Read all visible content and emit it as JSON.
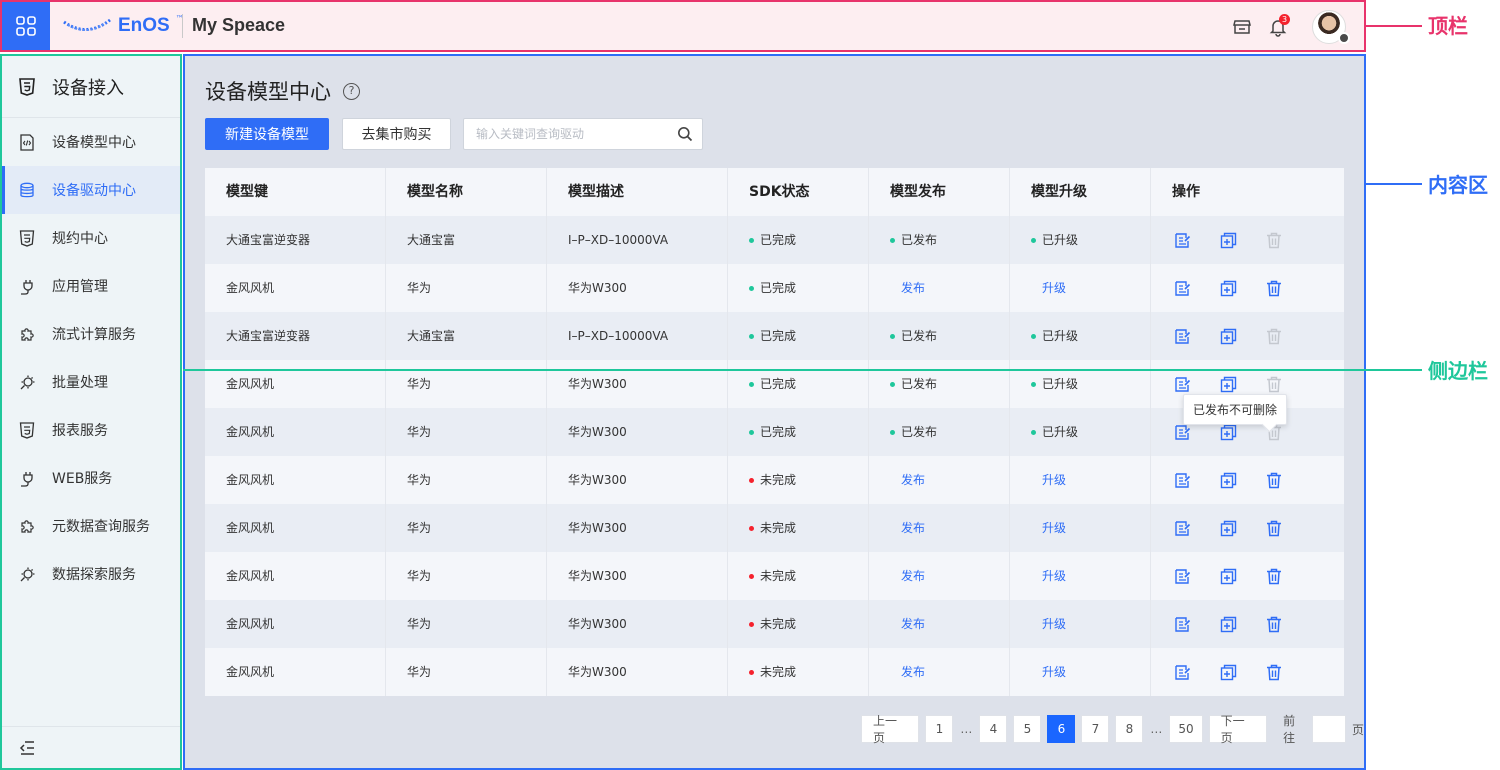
{
  "topbar": {
    "logo_text": "EnOS",
    "logo_tm": "™",
    "space_title": "My Speace",
    "notification_count": "3"
  },
  "annotations": {
    "topbar_label": "顶栏",
    "content_label": "内容区",
    "sidebar_label": "侧边栏",
    "topbar_color": "#e8336b",
    "content_color": "#2f6df6",
    "sidebar_color": "#1fc79b"
  },
  "sidebar": {
    "header": "设备接入",
    "items": [
      {
        "label": "设备模型中心",
        "icon": "code-doc-icon"
      },
      {
        "label": "设备驱动中心",
        "icon": "database-icon"
      },
      {
        "label": "规约中心",
        "icon": "html5-icon"
      },
      {
        "label": "应用管理",
        "icon": "plug-icon"
      },
      {
        "label": "流式计算服务",
        "icon": "puzzle-icon"
      },
      {
        "label": "批量处理",
        "icon": "gear-plug-icon"
      },
      {
        "label": "报表服务",
        "icon": "html5-icon"
      },
      {
        "label": "WEB服务",
        "icon": "plug-icon"
      },
      {
        "label": "元数据查询服务",
        "icon": "puzzle-icon"
      },
      {
        "label": "数据探索服务",
        "icon": "gear-plug-icon"
      }
    ]
  },
  "main": {
    "title": "设备模型中心",
    "help": "?",
    "new_button": "新建设备模型",
    "market_button": "去集市购买",
    "search_placeholder": "输入关键词查询驱动",
    "columns": [
      "模型键",
      "模型名称",
      "模型描述",
      "SDK状态",
      "模型发布",
      "模型升级",
      "操作"
    ],
    "rows": [
      {
        "key": "大通宝富逆变器",
        "name": "大通宝富",
        "desc": "I–P–XD–10000VA",
        "sdk": "已完成",
        "sdk_ok": true,
        "pub": "已发布",
        "pub_done": true,
        "up": "已升级",
        "up_done": true,
        "del_disabled": true
      },
      {
        "key": "金风风机",
        "name": "华为",
        "desc": "华为W300",
        "sdk": "已完成",
        "sdk_ok": true,
        "pub": "发布",
        "pub_done": false,
        "up": "升级",
        "up_done": false,
        "del_disabled": false
      },
      {
        "key": "大通宝富逆变器",
        "name": "大通宝富",
        "desc": "I–P–XD–10000VA",
        "sdk": "已完成",
        "sdk_ok": true,
        "pub": "已发布",
        "pub_done": true,
        "up": "已升级",
        "up_done": true,
        "del_disabled": true
      },
      {
        "key": "金风风机",
        "name": "华为",
        "desc": "华为W300",
        "sdk": "已完成",
        "sdk_ok": true,
        "pub": "已发布",
        "pub_done": true,
        "up": "已升级",
        "up_done": true,
        "del_disabled": true
      },
      {
        "key": "金风风机",
        "name": "华为",
        "desc": "华为W300",
        "sdk": "已完成",
        "sdk_ok": true,
        "pub": "已发布",
        "pub_done": true,
        "up": "已升级",
        "up_done": true,
        "del_disabled": true
      },
      {
        "key": "金风风机",
        "name": "华为",
        "desc": "华为W300",
        "sdk": "未完成",
        "sdk_ok": false,
        "pub": "发布",
        "pub_done": false,
        "up": "升级",
        "up_done": false,
        "del_disabled": false
      },
      {
        "key": "金风风机",
        "name": "华为",
        "desc": "华为W300",
        "sdk": "未完成",
        "sdk_ok": false,
        "pub": "发布",
        "pub_done": false,
        "up": "升级",
        "up_done": false,
        "del_disabled": false
      },
      {
        "key": "金风风机",
        "name": "华为",
        "desc": "华为W300",
        "sdk": "未完成",
        "sdk_ok": false,
        "pub": "发布",
        "pub_done": false,
        "up": "升级",
        "up_done": false,
        "del_disabled": false
      },
      {
        "key": "金风风机",
        "name": "华为",
        "desc": "华为W300",
        "sdk": "未完成",
        "sdk_ok": false,
        "pub": "发布",
        "pub_done": false,
        "up": "升级",
        "up_done": false,
        "del_disabled": false
      },
      {
        "key": "金风风机",
        "name": "华为",
        "desc": "华为W300",
        "sdk": "未完成",
        "sdk_ok": false,
        "pub": "发布",
        "pub_done": false,
        "up": "升级",
        "up_done": false,
        "del_disabled": false
      }
    ],
    "tooltip": "已发布不可删除",
    "pagination": {
      "prev": "上一页",
      "next": "下一页",
      "pages": [
        "1",
        "…",
        "4",
        "5",
        "6",
        "7",
        "8",
        "…",
        "50"
      ],
      "current": "6",
      "goto_label": "前往",
      "goto_suffix": "页"
    }
  },
  "colors": {
    "primary": "#2f6df6",
    "success": "#1fc79b",
    "danger": "#f5222d",
    "disabled": "#c4c8cf"
  }
}
